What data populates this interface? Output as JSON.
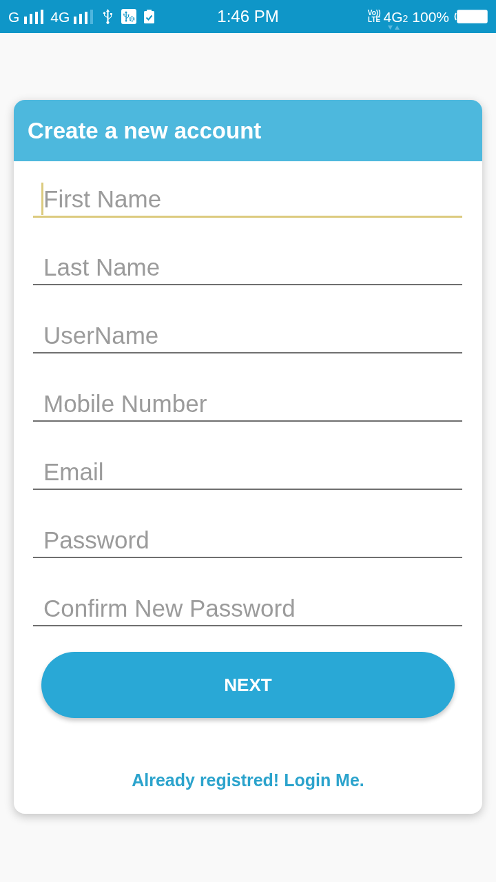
{
  "status_bar": {
    "network_1": "G",
    "network_2": "4G",
    "time": "1:46 PM",
    "volte": [
      "Vo))",
      "LTE"
    ],
    "data_network": "4G",
    "sim_slot": "2",
    "battery": "100%"
  },
  "card": {
    "title": "Create a new account"
  },
  "fields": [
    {
      "placeholder": "First Name",
      "focused": true
    },
    {
      "placeholder": "Last Name",
      "focused": false
    },
    {
      "placeholder": "UserName",
      "focused": false
    },
    {
      "placeholder": "Mobile Number",
      "focused": false
    },
    {
      "placeholder": "Email",
      "focused": false
    },
    {
      "placeholder": "Password",
      "focused": false
    },
    {
      "placeholder": "Confirm New Password",
      "focused": false
    }
  ],
  "next_button": {
    "label": "NEXT"
  },
  "login_link": {
    "text": "Already registred! Login Me."
  }
}
